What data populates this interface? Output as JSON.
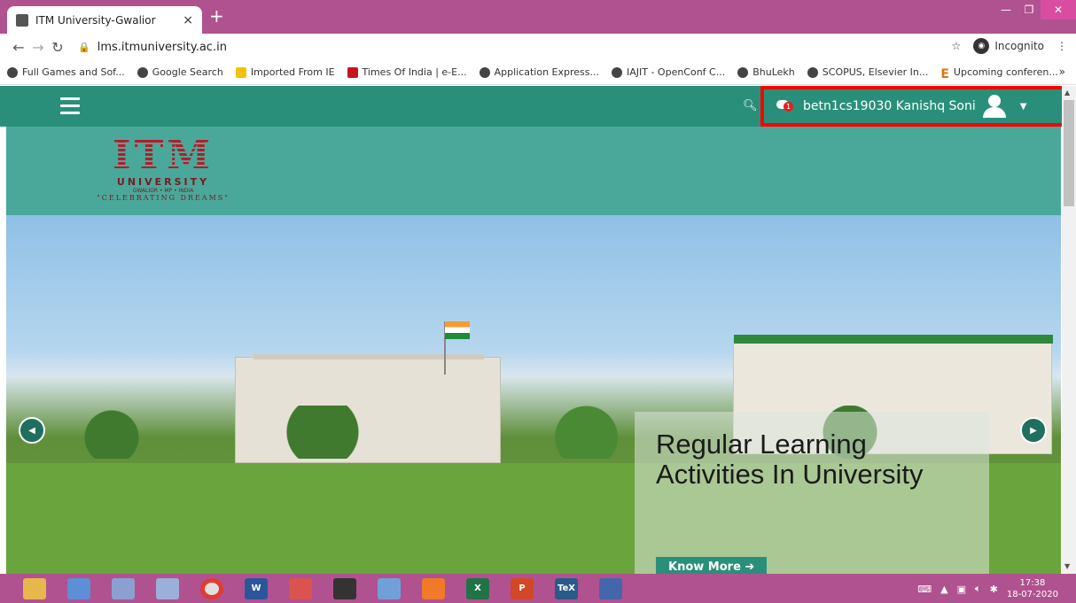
{
  "browser": {
    "tab_title": "ITM University-Gwalior",
    "tab_close": "×",
    "new_tab": "+",
    "url": "lms.itmuniversity.ac.in",
    "incognito_label": "Incognito",
    "bookmarks": [
      {
        "label": "Full Games and Sof...",
        "icon": "globe-icon"
      },
      {
        "label": "Google Search",
        "icon": "globe-icon"
      },
      {
        "label": "Imported From IE",
        "icon": "folder-icon"
      },
      {
        "label": "Times Of India | e-E...",
        "icon": "toi-icon"
      },
      {
        "label": "Application Express...",
        "icon": "globe-icon"
      },
      {
        "label": "IAJIT - OpenConf C...",
        "icon": "globe-icon"
      },
      {
        "label": "BhuLekh",
        "icon": "globe-icon"
      },
      {
        "label": "SCOPUS, Elsevier In...",
        "icon": "globe-icon"
      },
      {
        "label": "Upcoming conferen...",
        "icon": "e-icon"
      }
    ],
    "bookmarks_more": "»"
  },
  "navbar": {
    "notification_count": "1",
    "user_name": "betn1cs19030 Kanishq Soni",
    "accent": "#2a8f7a",
    "highlight_color": "#ff0000"
  },
  "logo": {
    "name": "ITM",
    "university": "UNIVERSITY",
    "location": "GWALIOR • MP • INDIA",
    "tagline": "\"CELEBRATING DREAMS\""
  },
  "hero": {
    "caption": "Regular Learning Activities In University",
    "button_label": "Know More ➔"
  },
  "taskbar": {
    "time": "17:38",
    "date": "18-07-2020"
  }
}
